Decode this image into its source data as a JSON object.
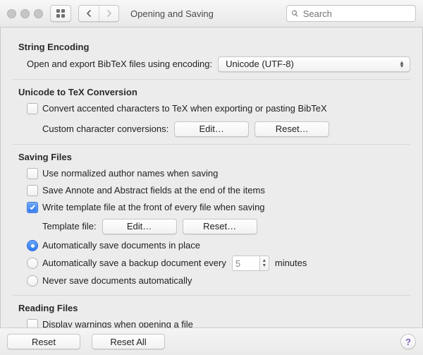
{
  "toolbar": {
    "title": "Opening and Saving",
    "search_placeholder": "Search"
  },
  "sections": {
    "encoding": {
      "title": "String Encoding",
      "label": "Open and export BibTeX files using encoding:",
      "value": "Unicode (UTF-8)"
    },
    "unicode": {
      "title": "Unicode to TeX Conversion",
      "convert_label": "Convert accented characters to TeX when exporting or pasting BibTeX",
      "custom_label": "Custom character conversions:",
      "edit": "Edit…",
      "reset": "Reset…"
    },
    "saving": {
      "title": "Saving Files",
      "normalize_label": "Use normalized author names when saving",
      "annote_label": "Save Annote and Abstract fields at the end of the items",
      "template_label": "Write template file at the front of every file when saving",
      "template_file_label": "Template file:",
      "edit": "Edit…",
      "reset": "Reset…",
      "radio_inplace": "Automatically save documents in place",
      "radio_backup": "Automatically save a backup document every",
      "backup_value": "5",
      "backup_unit": "minutes",
      "radio_never": "Never save documents automatically"
    },
    "reading": {
      "title": "Reading Files",
      "warnings_label": "Display warnings when opening a file"
    }
  },
  "footer": {
    "reset": "Reset",
    "reset_all": "Reset All",
    "help": "?"
  }
}
